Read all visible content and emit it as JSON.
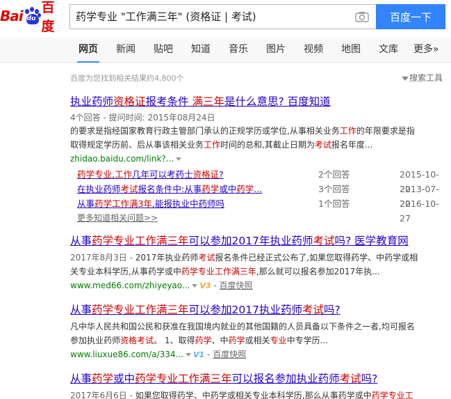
{
  "logo": {
    "text_bai": "Bai",
    "text_du": "du",
    "text_cn": "百度"
  },
  "search": {
    "query": "药学专业 \"工作满三年\" (资格证 | 考试)",
    "button": "百度一下"
  },
  "nav": {
    "items": [
      {
        "label": "网页",
        "active": true
      },
      {
        "label": "新闻"
      },
      {
        "label": "贴吧"
      },
      {
        "label": "知道"
      },
      {
        "label": "音乐"
      },
      {
        "label": "图片"
      },
      {
        "label": "视频"
      },
      {
        "label": "地图"
      },
      {
        "label": "文库"
      },
      {
        "label": "更多»"
      }
    ]
  },
  "stats": {
    "text": "百度为您找到相关结果约4,800个",
    "tools": "搜索工具"
  },
  "results": [
    {
      "title_parts": [
        "执业药师",
        "资格证",
        "报考条件 ",
        "满三年",
        "是什么意思? 百度知道"
      ],
      "meta": "4个回答 - 提问时间: 2015年08月24日",
      "abstract": [
        [
          "的要求是指经国家教育行政主管部门承认的正规学历或学位,从事相关业务",
          "工作",
          "的年限要求是指"
        ],
        [
          "取得规定学历前、后从事该相关业务",
          "工作",
          "时间的总和,其截止日期为",
          "考试",
          "报名年度..."
        ]
      ],
      "url": "zhidao.baidu.com/link?...",
      "sub": [
        {
          "parts": [
            "药学专业",
            ",",
            "工作",
            "几年可以考药士",
            "资格证",
            "?"
          ],
          "count": "2个回答",
          "date": "2015-10-22"
        },
        {
          "parts": [
            "在执业药师",
            "考试",
            "报名条件中:从事",
            "药学",
            "或中",
            "药学",
            "..."
          ],
          "count": "3个回答",
          "date": "2013-07-22"
        },
        {
          "parts": [
            "从事",
            "药学",
            "工作满3年",
            ",能报执业中药师吗"
          ],
          "count": "1个回答",
          "date": "2016-10-27"
        }
      ],
      "more": "更多知道相关问题>>"
    },
    {
      "title_parts": [
        "从事",
        "药学专业工作满三年",
        "可以参加2017年执业药师",
        "考试",
        "吗? 医学教育网"
      ],
      "abstract": [
        [
          "2017年8月3日 - ",
          "2017年执业药师",
          "考试",
          "报名条件已经正式公布了,如果您取得药学、中药学或相"
        ],
        [
          "关专业本科学历,从事药学或中",
          "药学专业工作满三年",
          ",那么就可以报名参加2017年执..."
        ]
      ],
      "url": "www.med66.com/zhiyeyao...",
      "badge": "V3",
      "snapshot": "百度快照"
    },
    {
      "title_parts": [
        "从事",
        "药学专业工作满三年",
        "可以参加2017执业药师",
        "考试",
        "吗?"
      ],
      "abstract": [
        [
          "凡中华人民共和国公民和获准在我国境内就业的其他国籍的人员具备以下条件之一者,均可报名"
        ],
        [
          "参加执业药师",
          "资格考试",
          "。 1、取得",
          "药学",
          "、中",
          "药学",
          "或相关",
          "专业",
          "中专学历..."
        ]
      ],
      "url": "www.liuxue86.com/a/334...",
      "badge": "V1",
      "snapshot": "百度快照"
    },
    {
      "title_parts": [
        "从事",
        "药学",
        "或中",
        "药学专业工作满三年",
        "可以报名参加执业药师",
        "考试",
        "吗?"
      ],
      "abstract": [
        [
          "2017年6月6日 - ",
          "如果您取得药学、中药学或相关专业本科学历,那么从事药学或中",
          "药学专业工"
        ]
      ]
    }
  ]
}
